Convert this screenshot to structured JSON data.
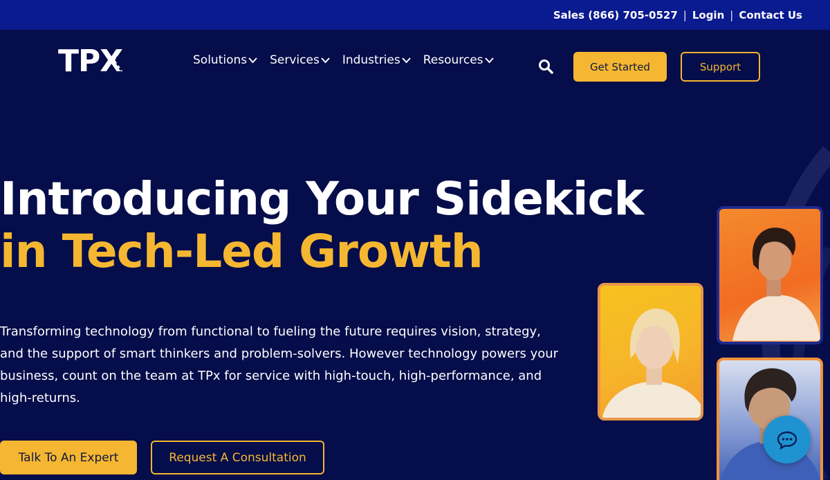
{
  "topbar": {
    "sales": "Sales (866) 705-0527",
    "login": "Login",
    "contact": "Contact Us",
    "separator": "|"
  },
  "nav": {
    "logo": "TPX",
    "menu": [
      {
        "label": "Solutions"
      },
      {
        "label": "Services"
      },
      {
        "label": "Industries"
      },
      {
        "label": "Resources"
      }
    ],
    "get_started": "Get Started",
    "support": "Support"
  },
  "hero": {
    "title_line1": "Introducing Your Sidekick",
    "title_line2": "in Tech-Led Growth",
    "description": "Transforming technology from functional to fueling the future requires vision, strategy, and the support of smart thinkers and problem-solvers. However technology powers your business, count on the team at TPx for service with high-touch, high-performance, and high-returns.",
    "cta_primary": "Talk To An Expert",
    "cta_secondary": "Request A Consultation"
  },
  "colors": {
    "topbar": "#0a1a8f",
    "background": "#050d4a",
    "accent": "#f5b731",
    "chat": "#1f93d2"
  },
  "icons": {
    "search": "search-icon",
    "chevron": "chevron-down-icon",
    "chat": "chat-bubble-icon"
  }
}
